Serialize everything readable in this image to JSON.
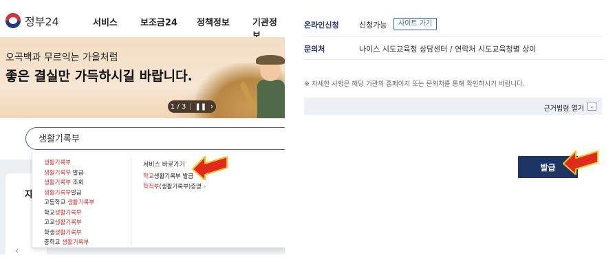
{
  "left_panel": {
    "logo_text": "정부24",
    "nav": [
      "서비스",
      "보조금24",
      "정책정보",
      "기관정보"
    ],
    "banner": {
      "line1": "오곡백과 무르익는 가을처럼",
      "line2": "좋은 결실만 가득하시길 바랍니다.",
      "pager": "1 / 3"
    },
    "search": {
      "value": "생활기록부"
    },
    "card_char": "자",
    "dropdown": {
      "suggestions": [
        {
          "hl": "생활기록부",
          "rest": ""
        },
        {
          "hl": "생활기록부",
          "rest": " 발급"
        },
        {
          "hl": "생활기록부",
          "rest": " 조회"
        },
        {
          "hl": "생활기록부",
          "rest": "발급"
        },
        {
          "pre": "고등학교 ",
          "hl": "생활기록부",
          "rest": ""
        },
        {
          "pre": "학교",
          "hl": "생활기록부",
          "rest": ""
        },
        {
          "pre": "고교",
          "hl": "생활기록부",
          "rest": ""
        },
        {
          "pre": "학생",
          "hl": "생활기록부",
          "rest": ""
        },
        {
          "pre": "중학교 ",
          "hl": "생활기록부",
          "rest": ""
        }
      ],
      "quick_title": "서비스 바로가기",
      "quick_links": [
        {
          "hl": "학교",
          "rest": "생활기록부 발급"
        },
        {
          "hl": "학적부",
          "rest": "(생활기록부)증명"
        }
      ]
    }
  },
  "right_panel": {
    "rows": [
      {
        "label": "온라인신청",
        "value": "신청가능",
        "button": "사이트 가기"
      },
      {
        "label": "문의처",
        "value": "나이스 시도교육청 상담센터 / 연락처 시도교육청별 상이"
      }
    ],
    "notice": "※ 자세한 사항은 해당 기관의 홈페이지 또는 문의처를 통해 확인하시기 바랍니다.",
    "law_toggle": "근거법령 열기",
    "issue_button": "발급"
  },
  "colors": {
    "highlight": "#d32f2f",
    "navy": "#1c3566",
    "link_blue": "#2f62c7",
    "arrow_red": "#e02a1e",
    "arrow_yellow": "#f2c318"
  }
}
